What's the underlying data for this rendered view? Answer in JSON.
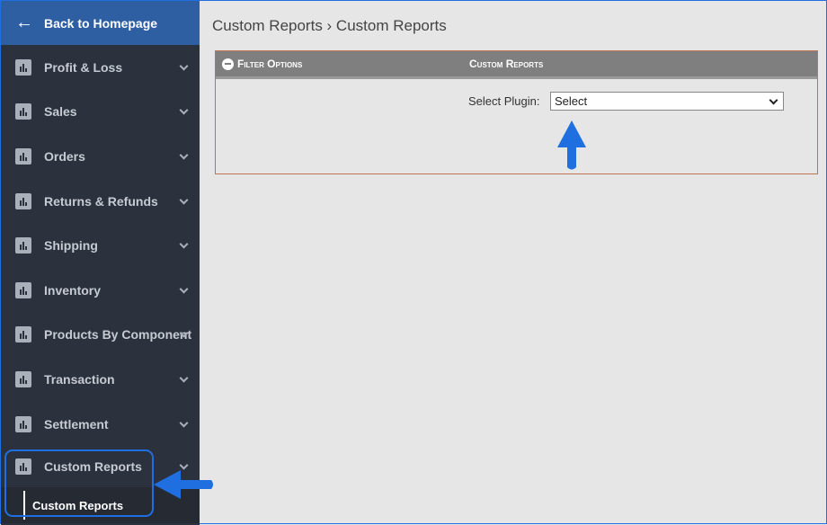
{
  "sidebar": {
    "back_label": "Back to Homepage",
    "items": [
      {
        "label": "Profit & Loss"
      },
      {
        "label": "Sales"
      },
      {
        "label": "Orders"
      },
      {
        "label": "Returns & Refunds"
      },
      {
        "label": "Shipping"
      },
      {
        "label": "Inventory"
      },
      {
        "label": "Products By Component"
      },
      {
        "label": "Transaction"
      },
      {
        "label": "Settlement"
      },
      {
        "label": "Custom Reports"
      }
    ],
    "sub_item": "Custom Reports"
  },
  "breadcrumb": "Custom Reports › Custom Reports",
  "panel": {
    "filter_label": "Filter Options",
    "title": "Custom Reports",
    "plugin_label": "Select Plugin:",
    "plugin_value": "Select"
  },
  "colors": {
    "sidebar": "#2c323d",
    "header": "#2e5fa3",
    "annotation": "#1f6fe0"
  }
}
